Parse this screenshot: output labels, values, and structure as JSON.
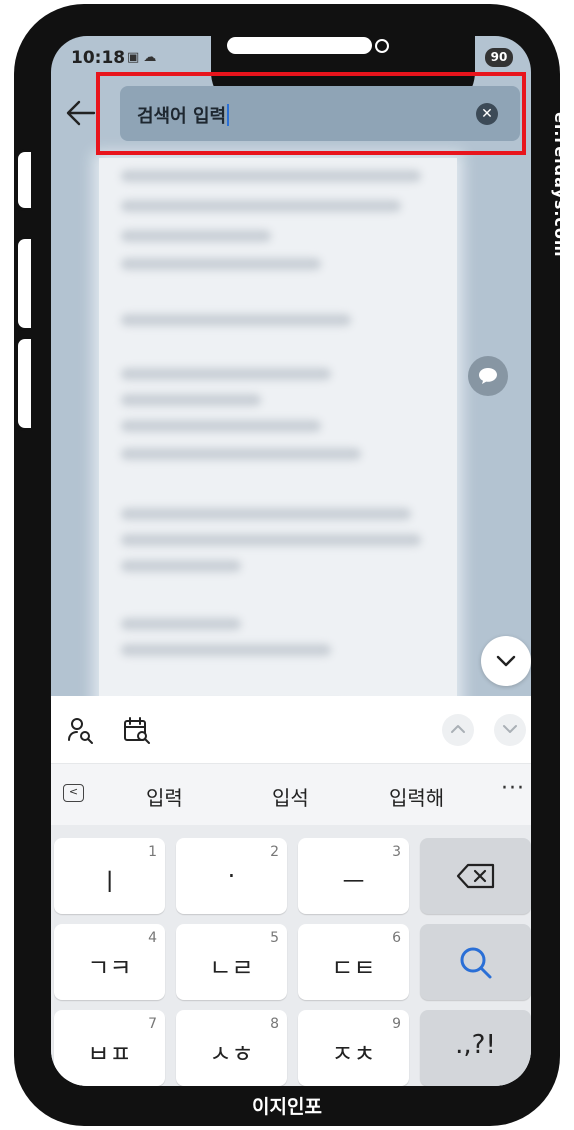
{
  "status_bar": {
    "time": "10:18",
    "battery": "90"
  },
  "search": {
    "query": "검색어 입력"
  },
  "suggestions": [
    "입력",
    "입석",
    "입력해"
  ],
  "keys": {
    "row1": [
      {
        "main": "ㅣ",
        "num": "1"
      },
      {
        "main": "·",
        "num": "2"
      },
      {
        "main": "ㅡ",
        "num": "3"
      }
    ],
    "row2": [
      {
        "main": "ㄱㅋ",
        "num": "4"
      },
      {
        "main": "ㄴㄹ",
        "num": "5"
      },
      {
        "main": "ㄷㅌ",
        "num": "6"
      }
    ],
    "row3": [
      {
        "main": "ㅂㅍ",
        "num": "7"
      },
      {
        "main": "ㅅㅎ",
        "num": "8"
      },
      {
        "main": "ㅈㅊ",
        "num": "9"
      }
    ],
    "punct": ".,?!"
  },
  "watermark": "ei.reidays.com",
  "footer": "이지인포",
  "colors": {
    "highlight": "#e8141c",
    "accent": "#2a6fd6"
  },
  "icons": [
    "back-arrow-icon",
    "clear-icon",
    "chat-icon",
    "chevron-down-icon",
    "contact-search-icon",
    "calendar-search-icon",
    "chevron-up-icon",
    "backspace-icon",
    "search-icon"
  ]
}
